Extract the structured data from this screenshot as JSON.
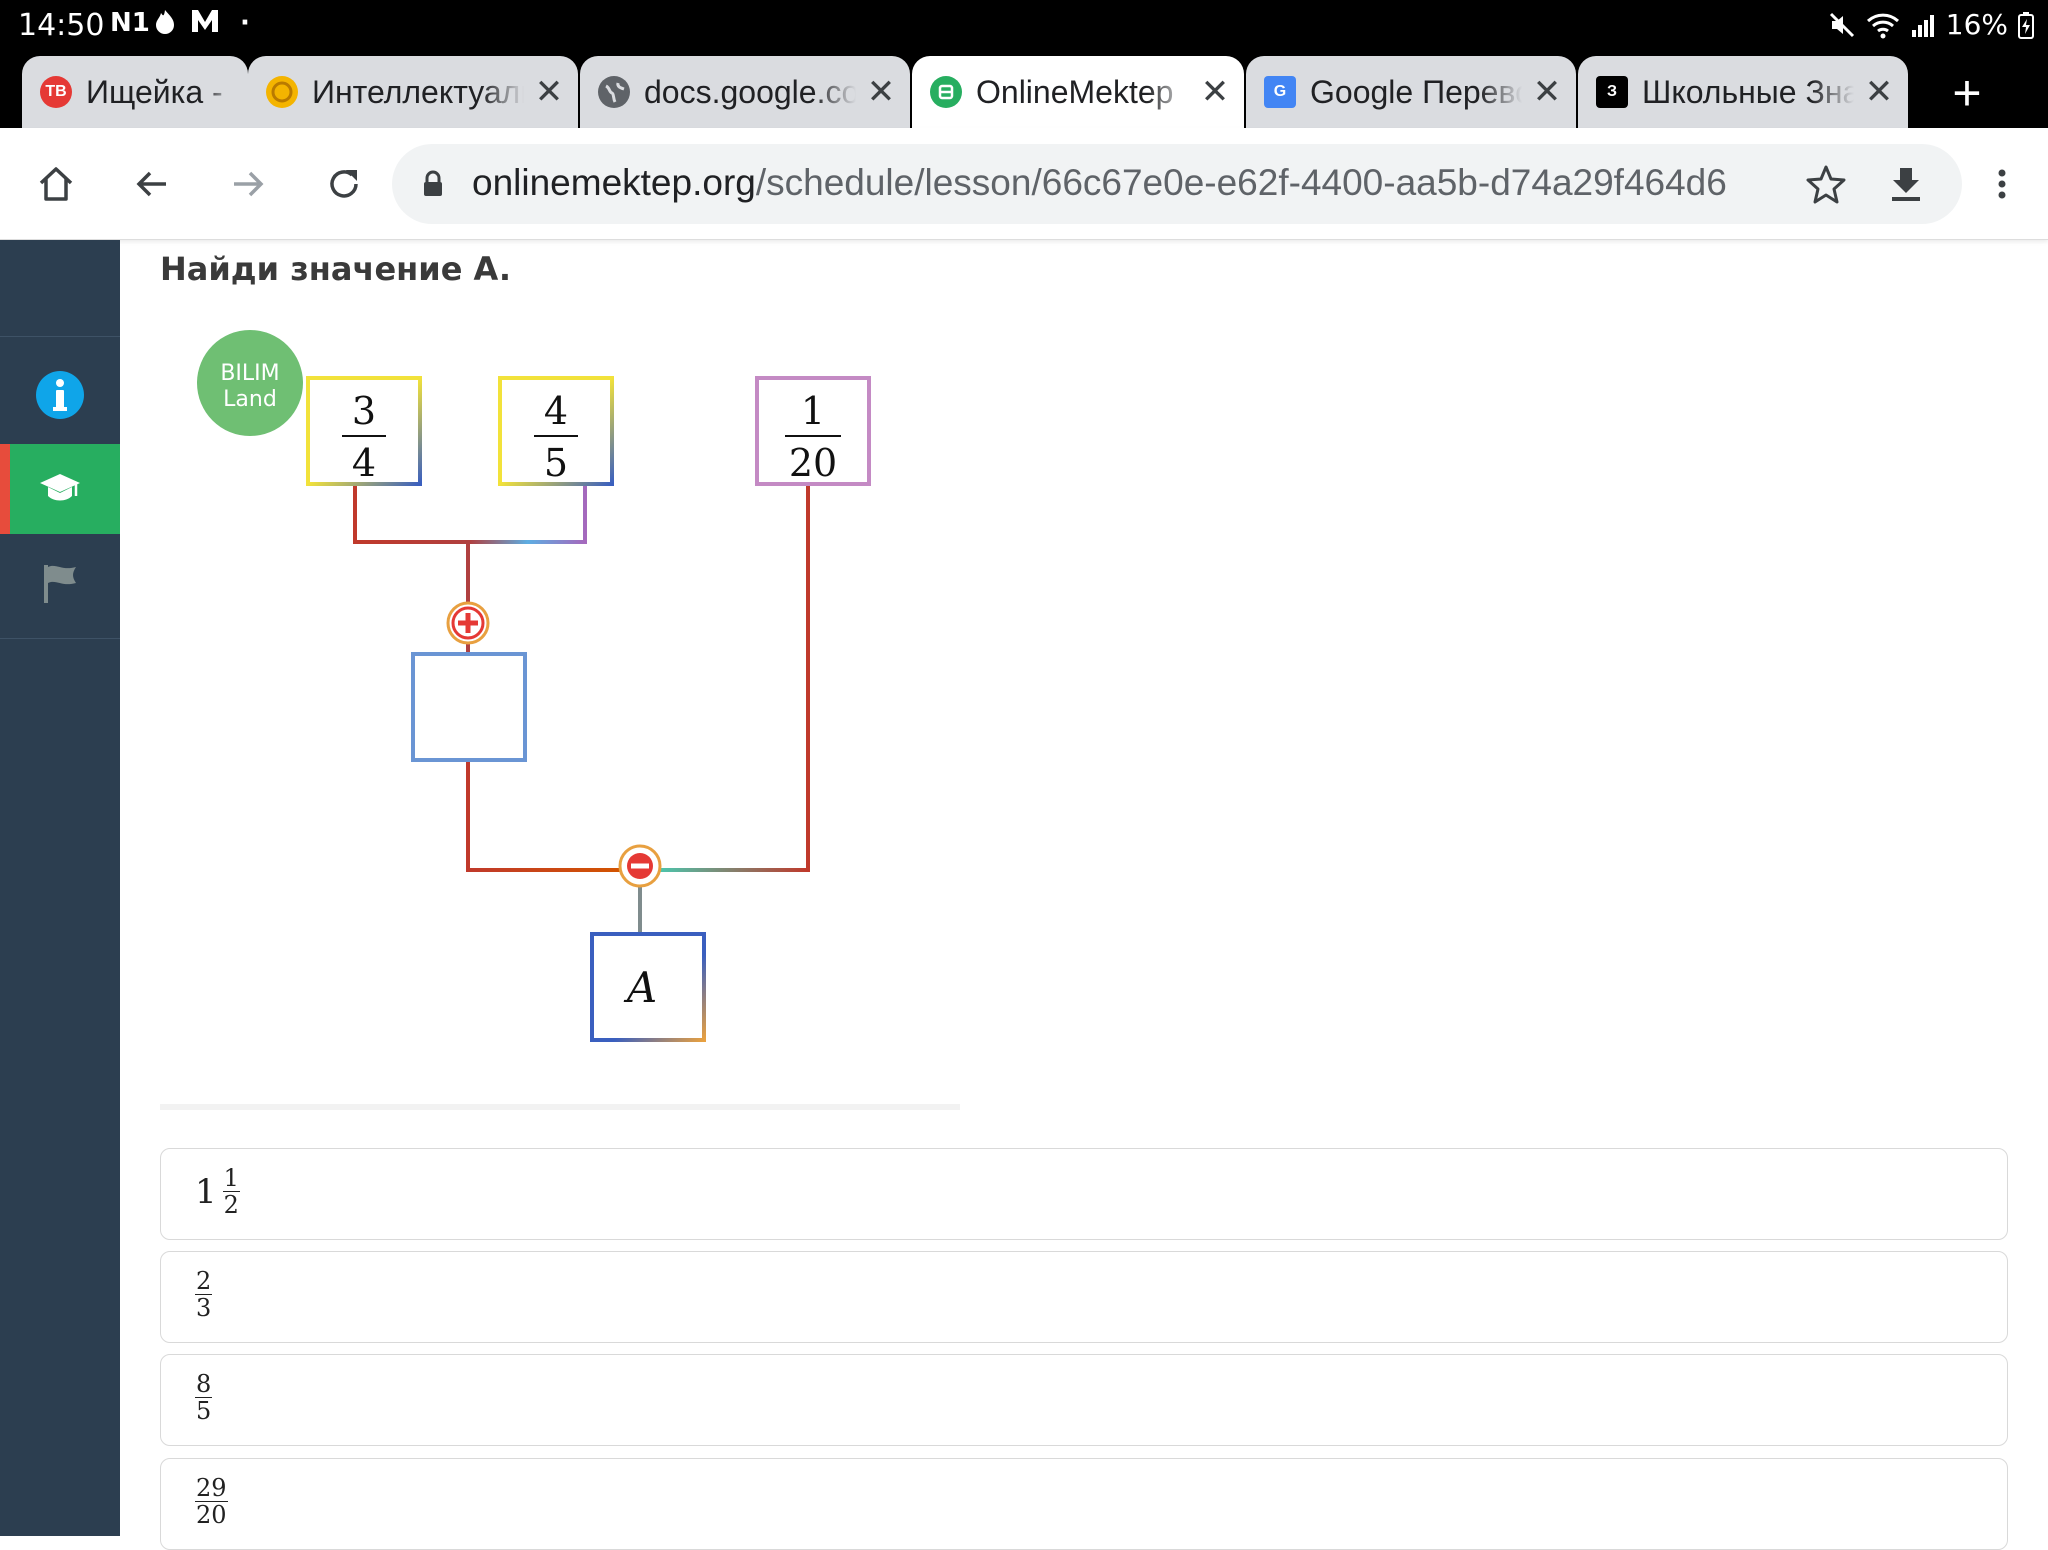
{
  "status_bar": {
    "time": "14:50",
    "left_icons": [
      "N1",
      "fire-icon",
      "M-icon",
      "dot"
    ],
    "battery": "16%"
  },
  "tabs": [
    {
      "title": "Ищейка - поиск",
      "favicon": "TB",
      "favicon_color": "#e53935",
      "active": false
    },
    {
      "title": "Интеллектуальный",
      "favicon": "coin",
      "favicon_color": "#f4b400",
      "active": false
    },
    {
      "title": "docs.google.com",
      "favicon": "globe",
      "favicon_color": "#5f6368",
      "active": false
    },
    {
      "title": "OnlineMektep",
      "favicon": "B",
      "favicon_color": "#27ae60",
      "active": true
    },
    {
      "title": "Google Переводчик",
      "favicon": "G",
      "favicon_color": "#4285f4",
      "active": false
    },
    {
      "title": "Школьные Знания",
      "favicon": "З",
      "favicon_color": "#000000",
      "active": false
    }
  ],
  "toolbar": {
    "url_host": "onlinemektep.org",
    "url_path": "/schedule/lesson/66c67e0e-e62f-4400-aa5b-d74a29f464d6"
  },
  "question": {
    "text": "Найди значение A."
  },
  "diagram": {
    "logo_line1": "BILIM",
    "logo_line2": "Land",
    "box1": {
      "num": "3",
      "den": "4"
    },
    "box2": {
      "num": "4",
      "den": "5"
    },
    "box3": {
      "num": "1",
      "den": "20"
    },
    "op1": "+",
    "op2": "−",
    "result_label": "A"
  },
  "options": [
    {
      "whole": "1",
      "num": "1",
      "den": "2"
    },
    {
      "whole": "",
      "num": "2",
      "den": "3"
    },
    {
      "whole": "",
      "num": "8",
      "den": "5"
    },
    {
      "whole": "",
      "num": "29",
      "den": "20"
    }
  ],
  "colors": {
    "sidebar_bg": "#2c3e50",
    "sidebar_active": "#27ae60",
    "info_icon": "#0fa5e9",
    "active_marker": "#e74c3c"
  }
}
